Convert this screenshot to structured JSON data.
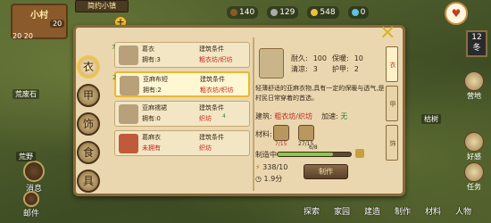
{
  "hud": {
    "sign_title": "小村",
    "sign_sub": "",
    "notice": "简约小镇",
    "population": "20",
    "stats_row": "20  20",
    "resources": [
      {
        "name": "wood",
        "value": "140",
        "color": "#8a5a2a"
      },
      {
        "name": "stone",
        "value": "129",
        "color": "#aaaaaa"
      },
      {
        "name": "coin",
        "value": "548",
        "color": "#e8c040"
      },
      {
        "name": "gem",
        "value": "0",
        "color": "#60c0e0"
      }
    ],
    "date_month": "12",
    "date_season": "冬"
  },
  "left_menu": [
    {
      "label": "消息"
    },
    {
      "label": "邮件"
    }
  ],
  "right_menu": [
    {
      "label": "营地"
    },
    {
      "label": "好感"
    },
    {
      "label": "任务"
    }
  ],
  "bottom_nav": [
    {
      "label": "探索"
    },
    {
      "label": "家园"
    },
    {
      "label": "建造"
    },
    {
      "label": "制作"
    },
    {
      "label": "材料"
    },
    {
      "label": "人物"
    }
  ],
  "map_labels": [
    {
      "text": "荒废石"
    },
    {
      "text": "荒野"
    },
    {
      "text": "枯树"
    }
  ],
  "categories": [
    {
      "glyph": "衣"
    },
    {
      "glyph": "甲"
    },
    {
      "glyph": "饰"
    },
    {
      "glyph": "食"
    },
    {
      "glyph": "具"
    }
  ],
  "recipes": [
    {
      "num": "7",
      "name": "葛衣",
      "owned": "拥有:3",
      "cond_h": "建筑条件",
      "cond_v": "粗衣坊/织坊",
      "num2": ""
    },
    {
      "num": "2",
      "name": "亚麻布短",
      "owned": "拥有:2",
      "cond_h": "建筑条件",
      "cond_v": "粗衣坊/织坊",
      "num2": ""
    },
    {
      "num": "",
      "name": "亚麻襦裙",
      "owned": "拥有:0",
      "cond_h": "建筑条件",
      "cond_v": "织坊",
      "num2": "4"
    },
    {
      "num": "",
      "name": "葛麻衣",
      "owned": "未拥有",
      "cond_h": "建筑条件",
      "cond_v": "织坊",
      "num2": ""
    }
  ],
  "detail": {
    "name": "亚麻布短",
    "stats": [
      {
        "label": "耐久:",
        "value": "100"
      },
      {
        "label": "保暖:",
        "value": "10"
      },
      {
        "label": "清凉:",
        "value": "3"
      },
      {
        "label": "护甲:",
        "value": "2"
      }
    ],
    "description": "轻薄舒适的亚麻衣物,具有一定的保暖与透气,是村民日常穿着的首选。",
    "building_label": "建筑:",
    "building_need": "粗衣坊/织坊",
    "speed_label": "加速:",
    "speed_value": "无",
    "materials_label": "材料:",
    "materials": [
      {
        "name": "亚麻",
        "count": "7/15"
      },
      {
        "name": "布料",
        "count": "27/15"
      }
    ],
    "progress_label": "制造中",
    "progress_text": "6/8",
    "progress_value": 0.75,
    "progress_cap": "",
    "cost": "338/10",
    "time": "1.9分",
    "make_button": "制作"
  },
  "right_tabs": [
    {
      "label": "衣"
    },
    {
      "label": "甲"
    },
    {
      "label": "饰"
    }
  ]
}
